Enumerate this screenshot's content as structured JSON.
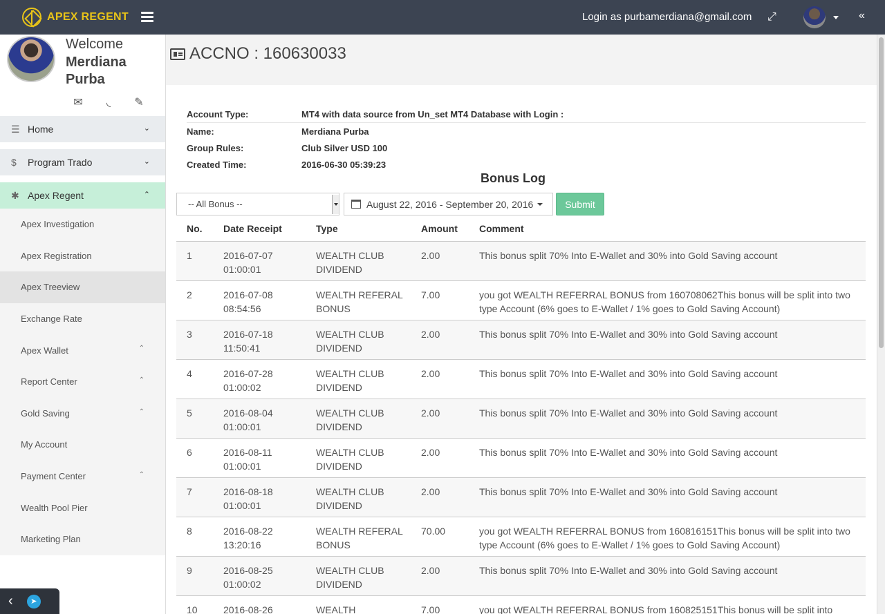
{
  "topbar": {
    "brand": "APEX REGENT",
    "login_text": "Login as purbamerdiana@gmail.com"
  },
  "profile": {
    "welcome": "Welcome",
    "name": "Merdiana Purba"
  },
  "nav": {
    "home": "Home",
    "program": "Program Trado",
    "apex": "Apex Regent",
    "sub_items": [
      {
        "label": "Apex Investigation"
      },
      {
        "label": "Apex Registration"
      },
      {
        "label": "Apex Treeview"
      },
      {
        "label": "Exchange Rate"
      },
      {
        "label": "Apex Wallet"
      },
      {
        "label": "Report Center"
      },
      {
        "label": "Gold Saving"
      },
      {
        "label": "My Account"
      },
      {
        "label": "Payment Center"
      },
      {
        "label": "Wealth Pool Pier"
      },
      {
        "label": "Marketing Plan"
      }
    ]
  },
  "page": {
    "title": "ACCNO : 160630033"
  },
  "account": {
    "type_label": "Account Type:",
    "type_value": "MT4 with data source from Un_set MT4 Database with Login :",
    "name_label": "Name:",
    "name_value": "Merdiana Purba",
    "group_label": "Group Rules:",
    "group_value": "Club Silver USD 100",
    "created_label": "Created Time:",
    "created_value": "2016-06-30 05:39:23"
  },
  "bonus": {
    "title": "Bonus Log",
    "select_value": "-- All Bonus --",
    "date_range": "August 22, 2016 - September 20, 2016",
    "submit": "Submit",
    "columns": {
      "no": "No.",
      "date": "Date Receipt",
      "type": "Type",
      "amount": "Amount",
      "comment": "Comment"
    },
    "rows": [
      {
        "no": "1",
        "date": "2016-07-07 01:00:01",
        "type": "WEALTH CLUB DIVIDEND",
        "amount": "2.00",
        "comment": "This bonus split 70% Into E-Wallet and 30% into Gold Saving account"
      },
      {
        "no": "2",
        "date": "2016-07-08 08:54:56",
        "type": "WEALTH REFERAL BONUS",
        "amount": "7.00",
        "comment": "you got WEALTH REFERRAL BONUS from 160708062This bonus will be split into two type Account (6% goes to E-Wallet / 1% goes to Gold Saving Account)"
      },
      {
        "no": "3",
        "date": "2016-07-18 11:50:41",
        "type": "WEALTH CLUB DIVIDEND",
        "amount": "2.00",
        "comment": "This bonus split 70% Into E-Wallet and 30% into Gold Saving account"
      },
      {
        "no": "4",
        "date": "2016-07-28 01:00:02",
        "type": "WEALTH CLUB DIVIDEND",
        "amount": "2.00",
        "comment": "This bonus split 70% Into E-Wallet and 30% into Gold Saving account"
      },
      {
        "no": "5",
        "date": "2016-08-04 01:00:01",
        "type": "WEALTH CLUB DIVIDEND",
        "amount": "2.00",
        "comment": "This bonus split 70% Into E-Wallet and 30% into Gold Saving account"
      },
      {
        "no": "6",
        "date": "2016-08-11 01:00:01",
        "type": "WEALTH CLUB DIVIDEND",
        "amount": "2.00",
        "comment": "This bonus split 70% Into E-Wallet and 30% into Gold Saving account"
      },
      {
        "no": "7",
        "date": "2016-08-18 01:00:01",
        "type": "WEALTH CLUB DIVIDEND",
        "amount": "2.00",
        "comment": "This bonus split 70% Into E-Wallet and 30% into Gold Saving account"
      },
      {
        "no": "8",
        "date": "2016-08-22 13:20:16",
        "type": "WEALTH REFERAL BONUS",
        "amount": "70.00",
        "comment": "you got WEALTH REFERRAL BONUS from 160816151This bonus will be split into two type Account (6% goes to E-Wallet / 1% goes to Gold Saving Account)"
      },
      {
        "no": "9",
        "date": "2016-08-25 01:00:02",
        "type": "WEALTH CLUB DIVIDEND",
        "amount": "2.00",
        "comment": "This bonus split 70% Into E-Wallet and 30% into Gold Saving account"
      },
      {
        "no": "10",
        "date": "2016-08-26",
        "type": "WEALTH",
        "amount": "7.00",
        "comment": "you got WEALTH REFERRAL BONUS from 160825151This bonus will be split into"
      }
    ]
  },
  "icons": {
    "brand": "apex-logo-icon",
    "menu": "hamburger-icon",
    "expand": "expand-icon",
    "collapse": "double-chevron-left-icon",
    "mail": "envelope-icon",
    "rss": "rss-icon",
    "settings": "wrench-icon"
  },
  "colors": {
    "topbar": "#3c4452",
    "brand": "#e9c418",
    "active_nav": "#c6efd9",
    "submit": "#6cc89a"
  }
}
